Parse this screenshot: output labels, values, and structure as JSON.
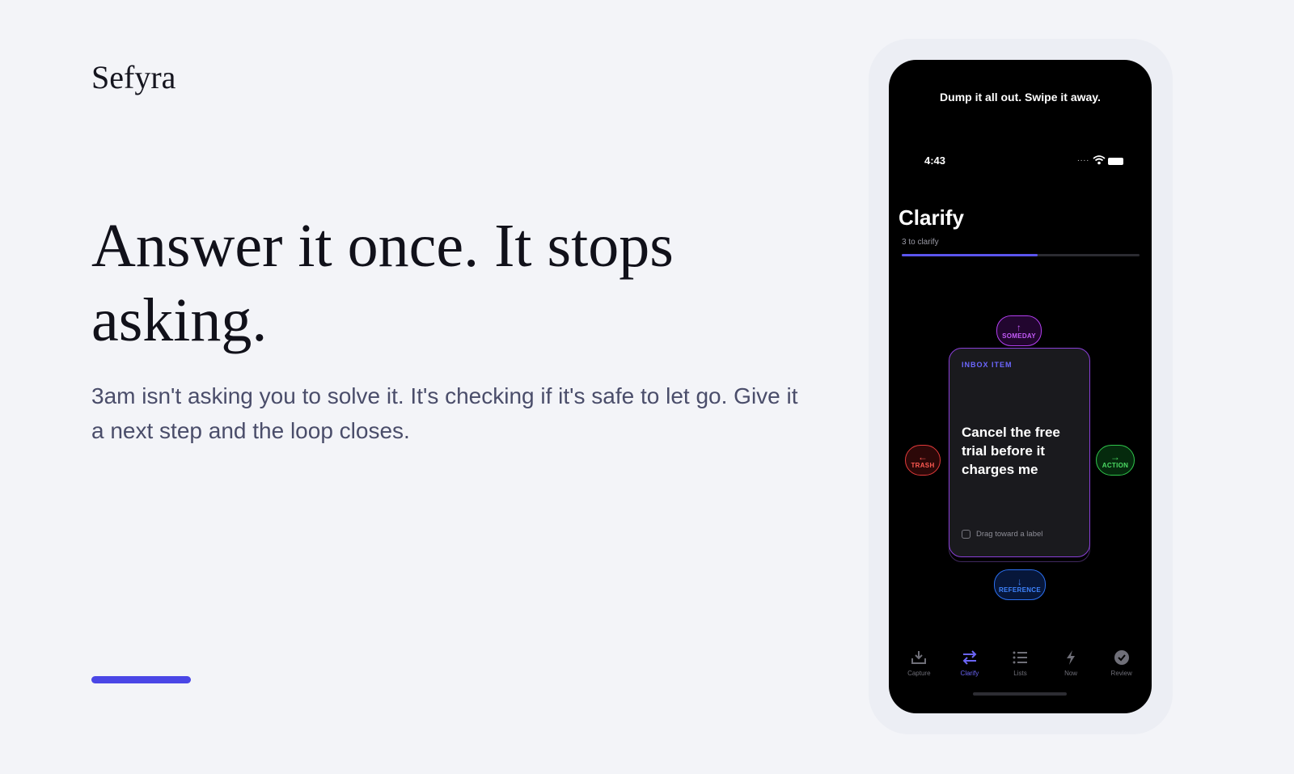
{
  "brand": "Sefyra",
  "hero": {
    "headline": "Answer it once. It stops asking.",
    "subtext": "3am isn't asking you to solve it. It's checking if it's safe to let go. Give it a next step and the loop closes."
  },
  "colors": {
    "accent": "#4a46e6",
    "background": "#f3f4f8",
    "someday": "#c35bf8",
    "trash": "#ff5a52",
    "action": "#4cdb64",
    "reference": "#3f84ff"
  },
  "phone": {
    "tagline": "Dump it all out. Swipe it away.",
    "status": {
      "time": "4:43",
      "signal_dots": "...."
    },
    "screen": {
      "title": "Clarify",
      "count": "3 to clarify",
      "progress": 0.57
    },
    "labels": {
      "someday": "SOMEDAY",
      "trash": "TRASH",
      "action": "ACTION",
      "reference": "REFERENCE"
    },
    "card": {
      "kicker": "INBOX ITEM",
      "text": "Cancel the free trial before it charges me",
      "hint": "Drag toward a label"
    },
    "tabs": [
      {
        "label": "Capture",
        "icon": "tray-download-icon"
      },
      {
        "label": "Clarify",
        "icon": "swap-arrows-icon",
        "active": true
      },
      {
        "label": "Lists",
        "icon": "list-icon"
      },
      {
        "label": "Now",
        "icon": "lightning-icon"
      },
      {
        "label": "Review",
        "icon": "check-circle-icon"
      }
    ]
  }
}
